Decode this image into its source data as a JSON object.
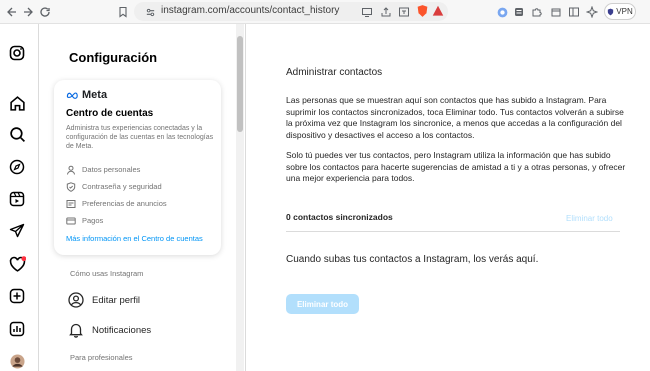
{
  "browser": {
    "url": "instagram.com/accounts/contact_history",
    "vpn_label": "VPN",
    "notif_count": "1"
  },
  "settings": {
    "title": "Configuración",
    "card": {
      "brand": "Meta",
      "title": "Centro de cuentas",
      "description": "Administra tus experiencias conectadas y la configuración de las cuentas en las tecnologías de Meta.",
      "items": [
        {
          "label": "Datos personales",
          "icon": "person-icon"
        },
        {
          "label": "Contraseña y seguridad",
          "icon": "shield-icon"
        },
        {
          "label": "Preferencias de anuncios",
          "icon": "ad-icon"
        },
        {
          "label": "Pagos",
          "icon": "card-icon"
        }
      ],
      "link": "Más información en el Centro de cuentas"
    },
    "section_how": "Cómo usas Instagram",
    "menu": [
      {
        "label": "Editar perfil",
        "icon": "profile-icon"
      },
      {
        "label": "Notificaciones",
        "icon": "bell-icon"
      }
    ],
    "section_pro": "Para profesionales"
  },
  "main": {
    "title": "Administrar contactos",
    "para1": "Las personas que se muestran aquí son contactos que has subido a Instagram. Para suprimir los contactos sincronizados, toca Eliminar todo. Tus contactos volverán a subirse la próxima vez que Instagram los sincronice, a menos que accedas a la configuración del dispositivo y desactives el acceso a los contactos.",
    "para2": "Solo tú puedes ver tus contactos, pero Instagram utiliza la información que has subido sobre los contactos para hacerte sugerencias de amistad a ti y a otras personas, y ofrecer una mejor experiencia para todos.",
    "count_label": "0 contactos sincronizados",
    "delete_link": "Eliminar todo",
    "empty_text": "Cuando subas tus contactos a Instagram, los verás aquí.",
    "delete_button": "Eliminar todo"
  },
  "colors": {
    "link_blue": "#0095f6",
    "disabled_blue": "#b2dffc",
    "text": "#262626",
    "secondary": "#737373",
    "notification_red": "#ff3040"
  }
}
